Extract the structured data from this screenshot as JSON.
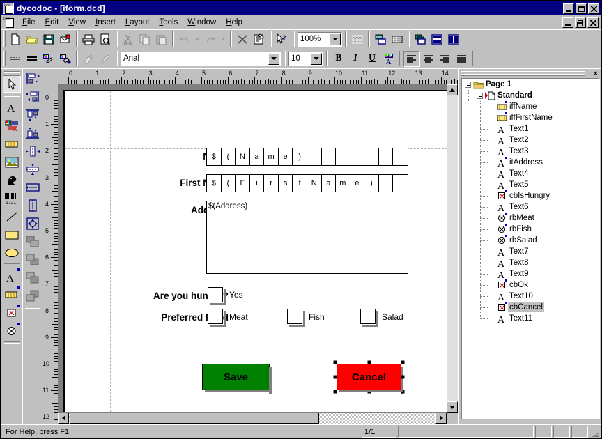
{
  "window": {
    "title": "dycodoc - [iform.dcd]",
    "app_icon": "document-dcd-icon",
    "buttons": {
      "minimize": "minimize",
      "maximize": "maximize",
      "close": "close",
      "mdi_minimize": "minimize",
      "mdi_restore": "restore",
      "mdi_close": "close"
    }
  },
  "menu": [
    {
      "label": "File",
      "accel": "F"
    },
    {
      "label": "Edit",
      "accel": "E"
    },
    {
      "label": "View",
      "accel": "V"
    },
    {
      "label": "Insert",
      "accel": "I"
    },
    {
      "label": "Layout",
      "accel": "L"
    },
    {
      "label": "Tools",
      "accel": "T"
    },
    {
      "label": "Window",
      "accel": "W"
    },
    {
      "label": "Help",
      "accel": "H"
    }
  ],
  "toolbar_standard": {
    "items": [
      {
        "name": "new-document-icon",
        "title": "New"
      },
      {
        "name": "open-folder-icon",
        "title": "Open"
      },
      {
        "name": "save-disk-icon",
        "title": "Save"
      },
      {
        "name": "send-mail-icon",
        "title": "Send"
      },
      {
        "name": "print-icon",
        "title": "Print"
      },
      {
        "name": "print-preview-icon",
        "title": "Print Preview"
      },
      {
        "name": "cut-scissors-icon",
        "title": "Cut"
      },
      {
        "name": "copy-icon",
        "title": "Copy"
      },
      {
        "name": "paste-icon",
        "title": "Paste"
      },
      {
        "name": "undo-icon",
        "title": "Undo"
      },
      {
        "name": "undo-dropdown-icon",
        "title": "Undo History"
      },
      {
        "name": "redo-icon",
        "title": "Redo"
      },
      {
        "name": "redo-dropdown-icon",
        "title": "Redo History"
      },
      {
        "name": "delete-x-icon",
        "title": "Delete"
      },
      {
        "name": "properties-icon",
        "title": "Properties"
      },
      {
        "name": "help-pointer-icon",
        "title": "Context Help"
      },
      {
        "name": "grid-icon",
        "title": "Grid"
      },
      {
        "name": "align-objects-icon",
        "title": "Align Objects"
      },
      {
        "name": "table-icon",
        "title": "Table"
      },
      {
        "name": "bring-to-front-icon",
        "title": "Bring To Front"
      },
      {
        "name": "layout-rows-icon",
        "title": "Rows"
      },
      {
        "name": "layout-columns-icon",
        "title": "Columns"
      }
    ],
    "zoom": {
      "value": "100%",
      "label": "Zoom"
    }
  },
  "toolbar_format": {
    "items": [
      {
        "name": "line-style-dotted-icon",
        "title": "Line Style"
      },
      {
        "name": "line-weight-icon",
        "title": "Line Weight"
      },
      {
        "name": "line-color-icon",
        "title": "Line Color"
      },
      {
        "name": "fill-color-icon",
        "title": "Fill Color"
      },
      {
        "name": "format-painter-icon",
        "title": "Format Painter"
      },
      {
        "name": "pen-icon",
        "title": "Pen"
      }
    ],
    "font": {
      "value": "Arial",
      "label": "Font"
    },
    "size": {
      "value": "10",
      "label": "Font Size"
    },
    "bold": "B",
    "italic": "I",
    "underline": "U",
    "font_color_icon": "font-color-icon",
    "align": [
      {
        "name": "align-left-icon",
        "active": true
      },
      {
        "name": "align-center-icon",
        "active": false
      },
      {
        "name": "align-right-icon",
        "active": false
      },
      {
        "name": "align-justify-icon",
        "active": false
      }
    ]
  },
  "palette_left": [
    {
      "name": "select-pointer-tool",
      "selected": true
    },
    {
      "name": "text-tool"
    },
    {
      "name": "rich-text-tool"
    },
    {
      "name": "field-tool"
    },
    {
      "name": "image-tool"
    },
    {
      "name": "ole-object-tool"
    },
    {
      "name": "barcode-tool",
      "label": "1721"
    },
    {
      "name": "line-tool"
    },
    {
      "name": "rectangle-tool"
    },
    {
      "name": "ellipse-tool"
    },
    {
      "name": "form-text-tool"
    },
    {
      "name": "form-field-tool"
    },
    {
      "name": "form-checkbox-tool"
    },
    {
      "name": "form-radio-tool"
    }
  ],
  "palette_right": [
    {
      "name": "align-left-edges-tool"
    },
    {
      "name": "align-right-edges-tool"
    },
    {
      "name": "align-top-edges-tool"
    },
    {
      "name": "align-bottom-edges-tool"
    },
    {
      "name": "center-horizontally-tool"
    },
    {
      "name": "center-vertically-tool"
    },
    {
      "name": "same-width-tool"
    },
    {
      "name": "same-height-tool"
    },
    {
      "name": "same-size-tool"
    },
    {
      "name": "bring-to-front-tool"
    },
    {
      "name": "send-to-back-tool"
    },
    {
      "name": "bring-forward-tool"
    },
    {
      "name": "send-backward-tool"
    }
  ],
  "rulers": {
    "horizontal": {
      "labels": [
        "0",
        "1",
        "2",
        "3",
        "4",
        "5",
        "6",
        "7",
        "8",
        "9",
        "10",
        "11",
        "12",
        "13",
        "14"
      ],
      "unit": "cm"
    },
    "vertical": {
      "labels": [
        "0",
        "1",
        "2",
        "3",
        "4",
        "5",
        "6",
        "7",
        "8",
        "9",
        "10",
        "11",
        "12"
      ],
      "unit": "cm"
    }
  },
  "form": {
    "fields": [
      {
        "name": "name-label",
        "type": "label",
        "text": "Name"
      },
      {
        "name": "first-name-label",
        "type": "label",
        "text": "First Name"
      },
      {
        "name": "address-label",
        "type": "label",
        "text": "Address"
      },
      {
        "name": "hungry-label",
        "type": "label",
        "text": "Are you hungry?"
      },
      {
        "name": "preferred-food-label",
        "type": "label",
        "text": "Preferred Food"
      }
    ],
    "name_field": {
      "value": "$(Name)",
      "cells": 14
    },
    "first_name_field": {
      "value": "$(FirstName)",
      "cells": 14
    },
    "address_field": {
      "value": "$(Address)"
    },
    "checkboxes": [
      {
        "name": "checkbox-yes",
        "label": "Yes",
        "checked": false
      },
      {
        "name": "checkbox-meat",
        "label": "Meat",
        "checked": false
      },
      {
        "name": "checkbox-fish",
        "label": "Fish",
        "checked": false
      },
      {
        "name": "checkbox-salad",
        "label": "Salad",
        "checked": false
      }
    ],
    "buttons": [
      {
        "name": "save-button",
        "label": "Save",
        "color": "#008000"
      },
      {
        "name": "cancel-button",
        "label": "Cancel",
        "color": "#ff0000",
        "selected": true
      }
    ]
  },
  "object_tree": {
    "close_label": "×",
    "nodes": [
      {
        "label": "Page 1",
        "depth": 0,
        "icon": "folder-icon",
        "bold": true,
        "expander": true
      },
      {
        "label": "Standard",
        "depth": 1,
        "icon": "layer-page-icon",
        "bold": true,
        "expander": true
      },
      {
        "label": "iffName",
        "depth": 2,
        "icon": "field-icon",
        "blue_dot": true
      },
      {
        "label": "iffFirstName",
        "depth": 2,
        "icon": "field-icon",
        "blue_dot": true
      },
      {
        "label": "Text1",
        "depth": 2,
        "icon": "text-icon"
      },
      {
        "label": "Text2",
        "depth": 2,
        "icon": "text-icon"
      },
      {
        "label": "Text3",
        "depth": 2,
        "icon": "text-icon"
      },
      {
        "label": "itAddress",
        "depth": 2,
        "icon": "text-icon",
        "blue_dot": true
      },
      {
        "label": "Text4",
        "depth": 2,
        "icon": "text-icon"
      },
      {
        "label": "Text5",
        "depth": 2,
        "icon": "text-icon"
      },
      {
        "label": "cbIsHungry",
        "depth": 2,
        "icon": "checkbox-icon",
        "blue_dot": true
      },
      {
        "label": "Text6",
        "depth": 2,
        "icon": "text-icon"
      },
      {
        "label": "rbMeat",
        "depth": 2,
        "icon": "radio-icon",
        "blue_dot": true
      },
      {
        "label": "rbFish",
        "depth": 2,
        "icon": "radio-icon",
        "blue_dot": true
      },
      {
        "label": "rbSalad",
        "depth": 2,
        "icon": "radio-icon",
        "blue_dot": true
      },
      {
        "label": "Text7",
        "depth": 2,
        "icon": "text-icon"
      },
      {
        "label": "Text8",
        "depth": 2,
        "icon": "text-icon"
      },
      {
        "label": "Text9",
        "depth": 2,
        "icon": "text-icon"
      },
      {
        "label": "cbOk",
        "depth": 2,
        "icon": "checkbox-icon",
        "blue_dot": true
      },
      {
        "label": "Text10",
        "depth": 2,
        "icon": "text-icon"
      },
      {
        "label": "cbCancel",
        "depth": 2,
        "icon": "checkbox-icon",
        "blue_dot": true,
        "selected": true
      },
      {
        "label": "Text11",
        "depth": 2,
        "icon": "text-icon"
      }
    ]
  },
  "statusbar": {
    "help_text": "For Help, press F1",
    "page_indicator": "1/1",
    "panel_wide": "",
    "panel_a": "",
    "panel_b": "",
    "panel_c": ""
  }
}
